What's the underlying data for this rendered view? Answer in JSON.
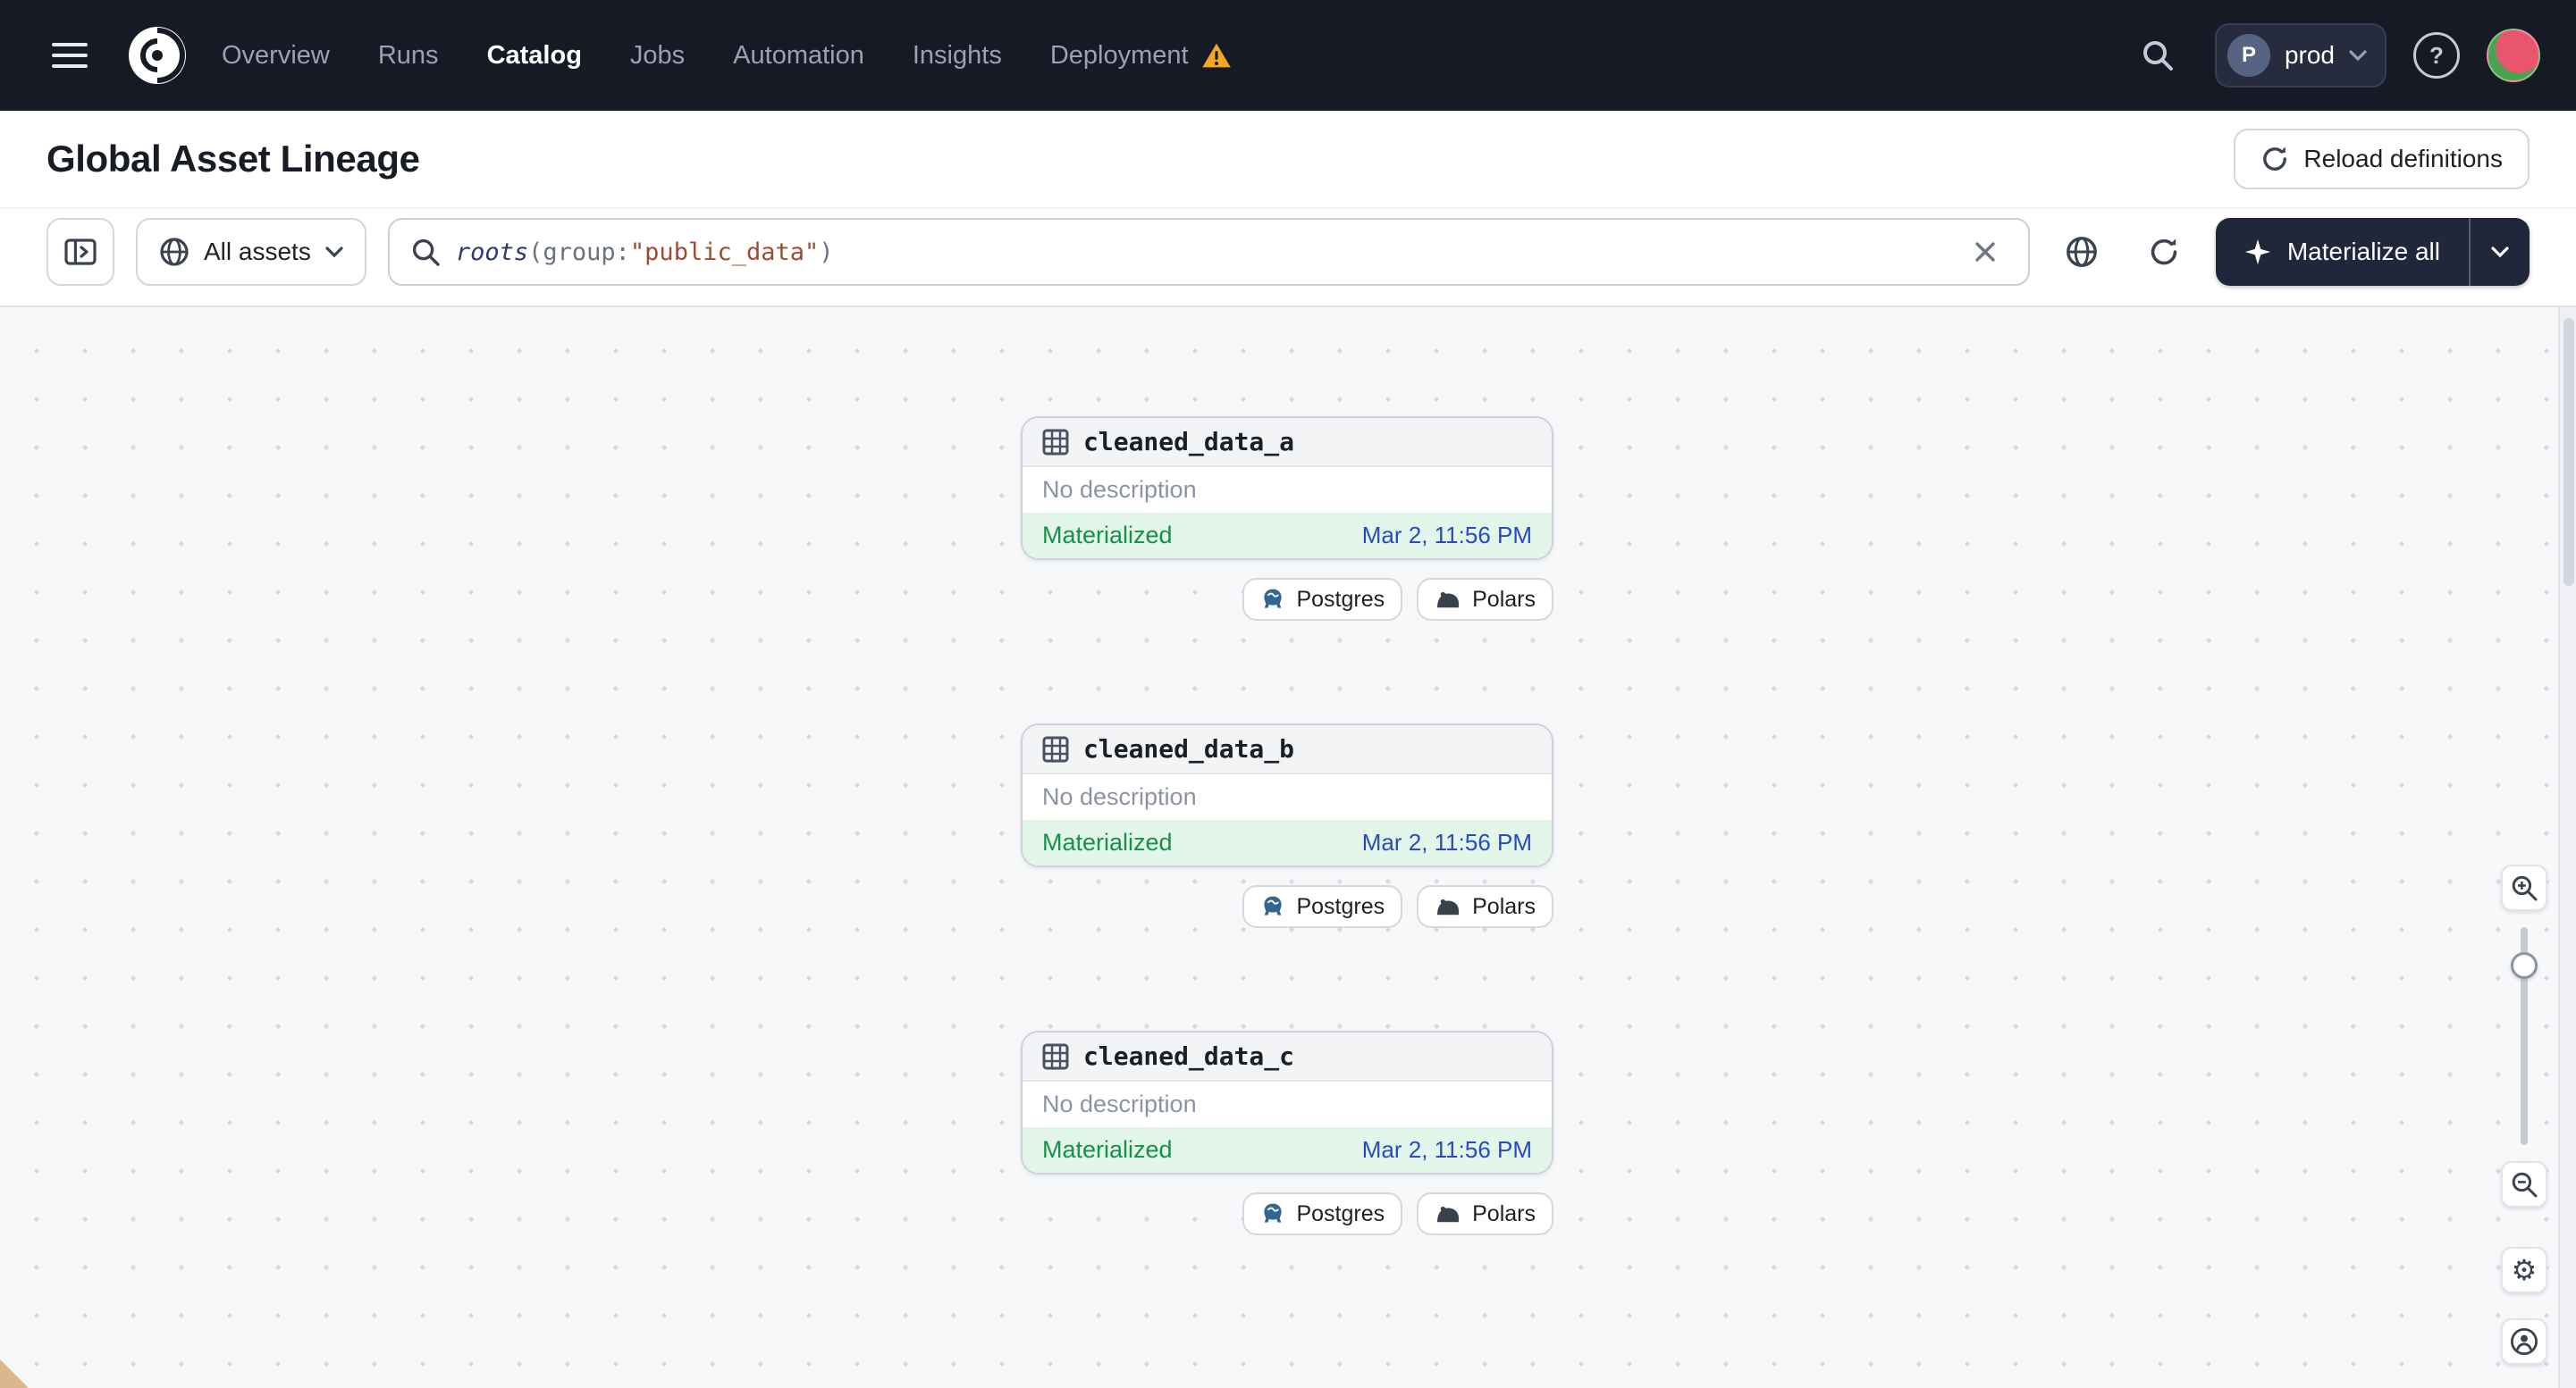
{
  "nav": {
    "links": [
      {
        "label": "Overview"
      },
      {
        "label": "Runs"
      },
      {
        "label": "Catalog",
        "active": true
      },
      {
        "label": "Jobs"
      },
      {
        "label": "Automation"
      },
      {
        "label": "Insights"
      },
      {
        "label": "Deployment",
        "warning": true
      }
    ],
    "deployment": {
      "initial": "P",
      "name": "prod"
    }
  },
  "header": {
    "title": "Global Asset Lineage",
    "reload_label": "Reload definitions"
  },
  "toolbar": {
    "filter_label": "All assets",
    "query": {
      "function": "roots",
      "punct_open": "(",
      "key": "group:",
      "value": "\"public_data\"",
      "punct_close": ")"
    },
    "materialize_label": "Materialize all"
  },
  "graph": {
    "nodes": [
      {
        "name": "cleaned_data_a",
        "description": "No description",
        "status": "Materialized",
        "timestamp": "Mar 2, 11:56 PM",
        "tags": [
          {
            "label": "Postgres"
          },
          {
            "label": "Polars"
          }
        ]
      },
      {
        "name": "cleaned_data_b",
        "description": "No description",
        "status": "Materialized",
        "timestamp": "Mar 2, 11:56 PM",
        "tags": [
          {
            "label": "Postgres"
          },
          {
            "label": "Polars"
          }
        ]
      },
      {
        "name": "cleaned_data_c",
        "description": "No description",
        "status": "Materialized",
        "timestamp": "Mar 2, 11:56 PM",
        "tags": [
          {
            "label": "Postgres"
          },
          {
            "label": "Polars"
          }
        ]
      }
    ]
  },
  "colors": {
    "nav_background": "#161a25",
    "status_green": "#18904a",
    "status_green_bg": "#e2f7e9",
    "timestamp_blue": "#2a4bbf",
    "warning_amber": "#f5a623",
    "primary_button": "#20273a"
  }
}
